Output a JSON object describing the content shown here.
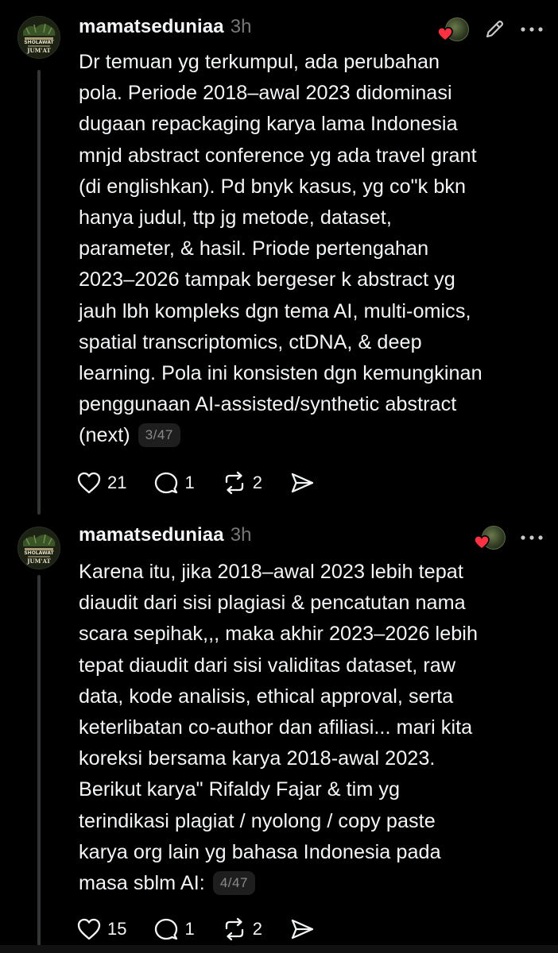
{
  "posts": [
    {
      "username": "mamatseduniaa",
      "timestamp": "3h",
      "avatar_text": [
        "SHOLAWAT",
        "JUM'AT"
      ],
      "lines": [
        "Dr temuan yg terkumpul, ada perubahan",
        "pola. Periode 2018–awal 2023 didominasi",
        "dugaan repackaging karya lama Indonesia",
        "mnjd abstract conference yg ada travel grant",
        "(di englishkan). Pd bnyk kasus, yg co\"k bkn",
        "hanya judul, ttp jg metode, dataset,",
        "parameter, & hasil. Priode pertengahan",
        "2023–2026 tampak bergeser k abstract yg",
        "jauh lbh kompleks dgn tema AI, multi-omics,",
        "spatial transcriptomics, ctDNA, & deep",
        "learning. Pola ini konsisten dgn kemungkinan",
        "penggunaan AI-assisted/synthetic abstract",
        "(next)"
      ],
      "thread_counter": "3/47",
      "likes": "21",
      "replies": "1",
      "reposts": "2",
      "has_edit": true
    },
    {
      "username": "mamatseduniaa",
      "timestamp": "3h",
      "avatar_text": [
        "SHOLAWAT",
        "JUM'AT"
      ],
      "lines": [
        "Karena itu, jika 2018–awal 2023 lebih tepat",
        "diaudit dari sisi plagiasi & pencatutan nama",
        "scara sepihak,,, maka akhir 2023–2026 lebih",
        "tepat diaudit dari sisi validitas dataset, raw",
        "data, kode analisis, ethical approval, serta",
        "keterlibatan co-author dan afiliasi... mari kita",
        "koreksi bersama karya 2018-awal 2023.",
        "Berikut karya\" Rifaldy Fajar & tim yg",
        "terindikasi plagiat / nyolong / copy paste",
        "karya org lain yg bahasa Indonesia pada",
        "masa sblm AI:"
      ],
      "thread_counter": "4/47",
      "likes": "15",
      "replies": "1",
      "reposts": "2",
      "has_edit": false
    }
  ],
  "icons": {
    "like": "heart-icon",
    "reply": "comment-icon",
    "repost": "repost-icon",
    "share": "send-icon",
    "edit": "pencil-icon",
    "more": "more-icon"
  },
  "colors": {
    "background": "#000000",
    "text": "#f3f5f7",
    "muted": "#777777",
    "heart_badge": "#ff3040",
    "thread_line": "#333638"
  }
}
